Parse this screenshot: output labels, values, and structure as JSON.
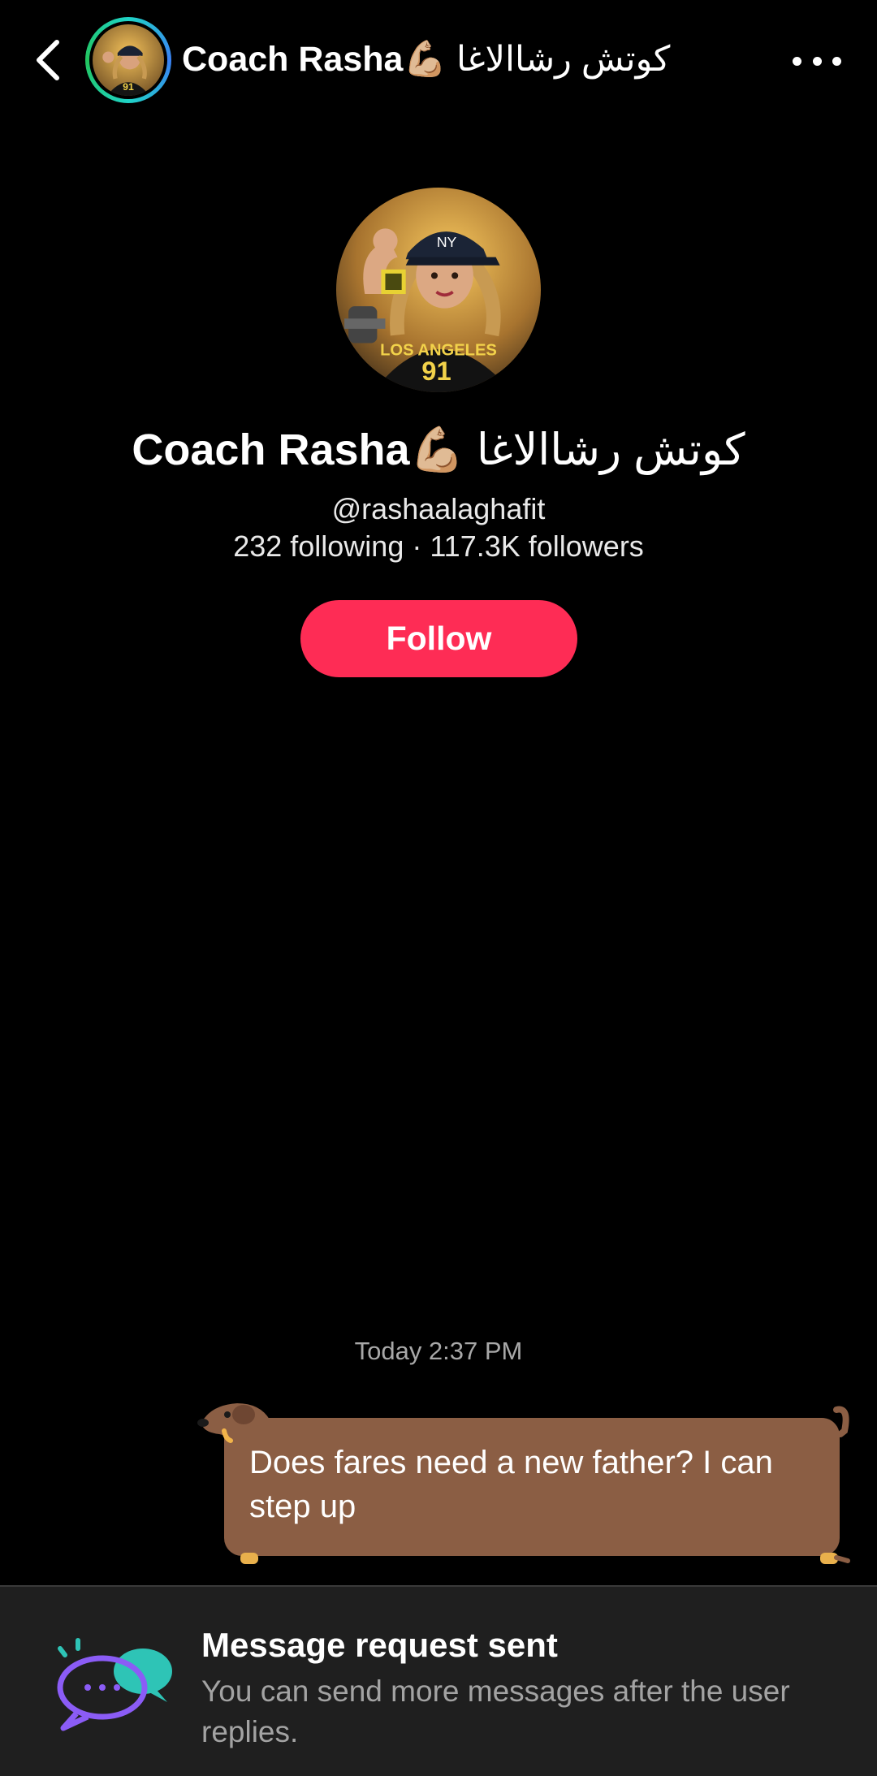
{
  "header": {
    "name": "Coach Rasha",
    "emoji": "💪🏼",
    "arabic_name": "كوتش رشاالاغا",
    "back_icon": "chevron-left-icon",
    "more_icon": "more-horizontal-icon",
    "avatar_ring_color": "#1fd3c6"
  },
  "profile": {
    "name": "Coach Rasha",
    "emoji": "💪🏼",
    "arabic_name": "كوتش رشاالاغا",
    "handle": "@rashaalaghafit",
    "stats": "232 following · 117.3K followers",
    "follow_label": "Follow",
    "follow_color": "#fe2c55"
  },
  "chat": {
    "timestamp": "Today 2:37 PM",
    "messages": [
      {
        "text": "Does fares need a new father? I can step up",
        "sender": "me",
        "bubble_color": "#8b5e44"
      }
    ]
  },
  "banner": {
    "title": "Message request sent",
    "subtitle": "You can send more messages after the user replies.",
    "icon": "chat-bubbles-icon"
  }
}
